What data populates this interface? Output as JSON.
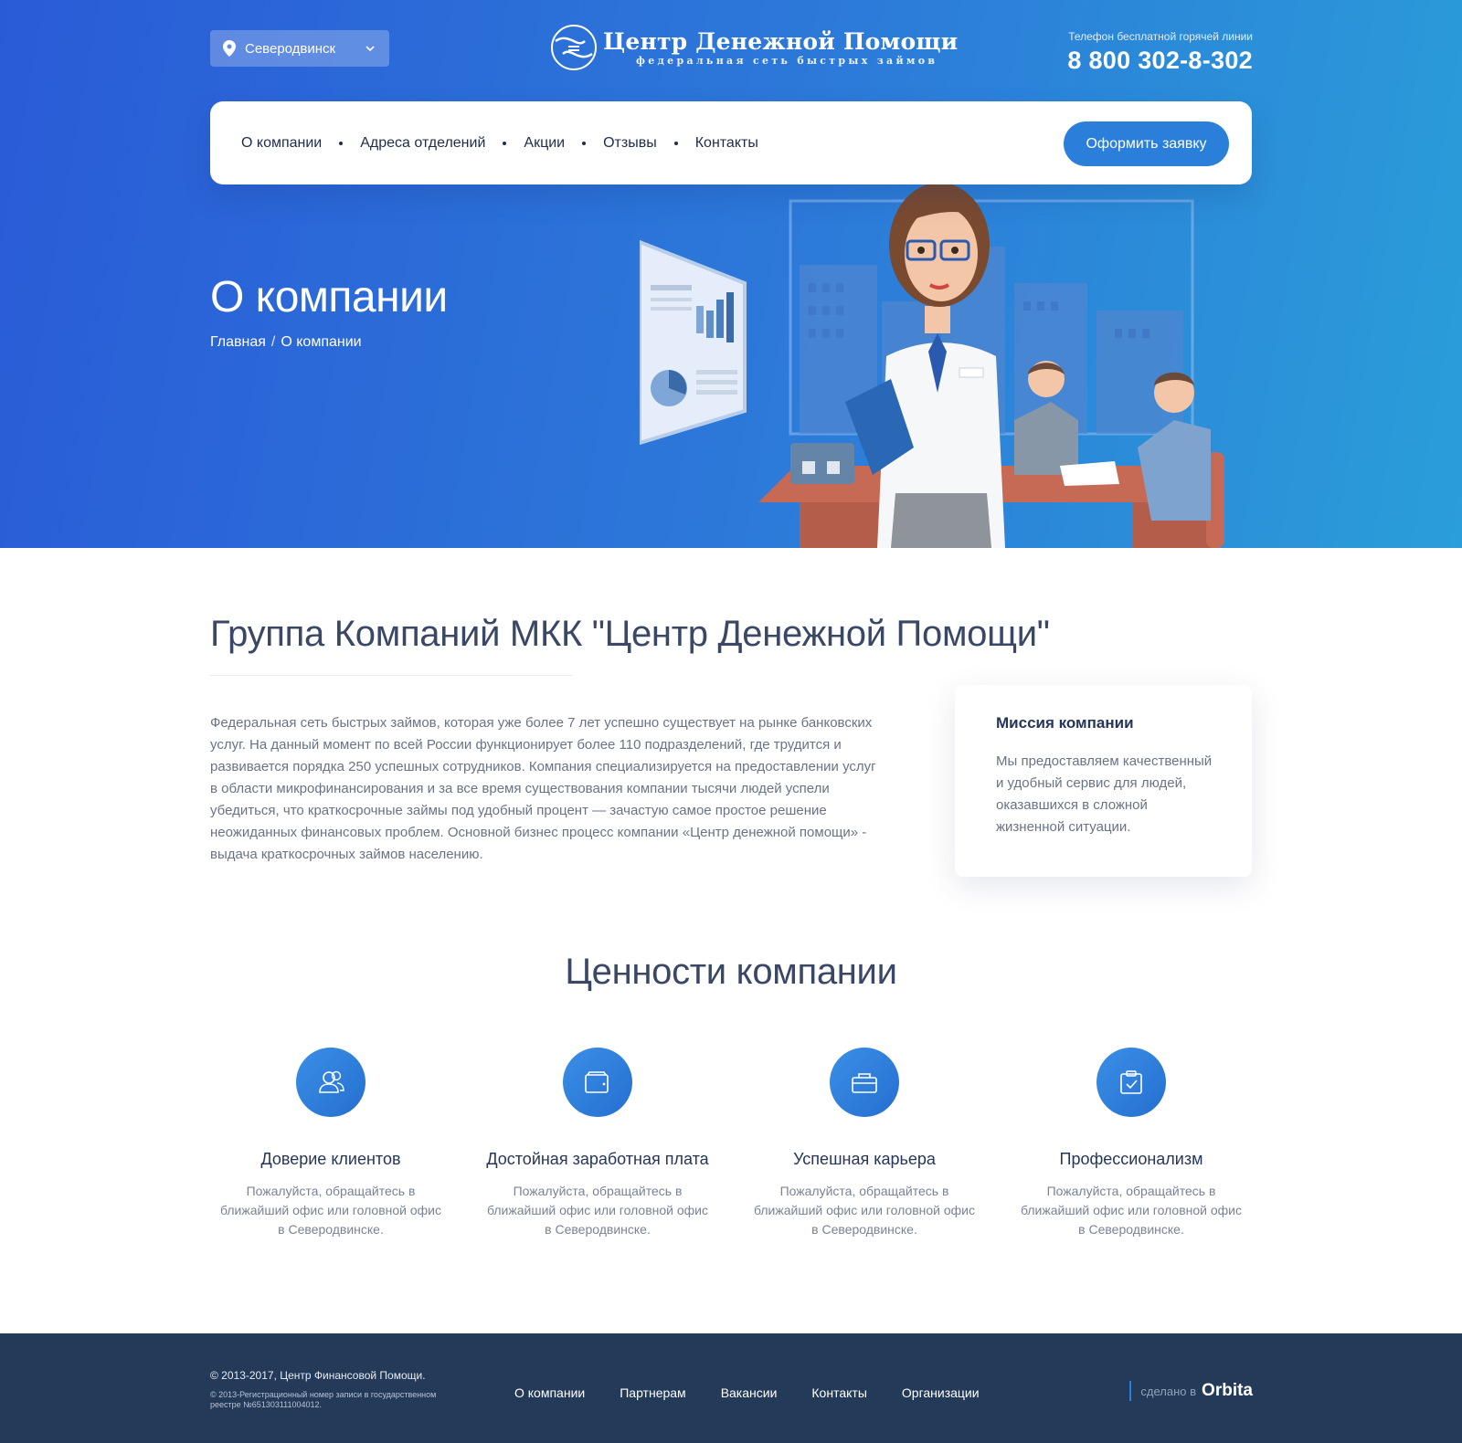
{
  "header": {
    "city": "Северодвинск",
    "logo_title": "Центр Денежной Помощи",
    "logo_subtitle": "федеральная сеть быстрых займов",
    "hotline_label": "Телефон бесплатной горячей линии",
    "hotline_phone": "8 800 302-8-302"
  },
  "nav": {
    "items": [
      "О компании",
      "Адреса отделений",
      "Акции",
      "Отзывы",
      "Контакты"
    ],
    "cta": "Оформить заявку"
  },
  "hero": {
    "title": "О компании",
    "breadcrumb_home": "Главная",
    "breadcrumb_sep": "/",
    "breadcrumb_current": "О компании"
  },
  "about": {
    "title": "Группа Компаний МКК \"Центр Денежной Помощи\"",
    "text": "Федеральная сеть быстрых займов, которая уже более 7 лет успешно существует на рынке банковских услуг. На данный момент по всей России функционирует более 110 подразделений, где трудится и развивается порядка 250 успешных сотрудников. Компания специализируется на предоставлении услуг в области микрофинансирования и за все время существования компании тысячи людей успели убедиться, что краткосрочные займы под удобный процент — зачастую самое простое решение неожиданных финансовых проблем. Основной бизнес процесс компании «Центр денежной помощи» - выдача краткосрочных займов населению.",
    "mission_title": "Миссия компании",
    "mission_text": "Мы предоставляем качественный и удобный сервис для людей, оказавшихся в сложной жизненной ситуации."
  },
  "values": {
    "title": "Ценности компании",
    "items": [
      {
        "icon": "users-icon",
        "title": "Доверие клиентов",
        "text": "Пожалуйста, обращайтесь в ближайший офис или головной офис в Северодвинске."
      },
      {
        "icon": "wallet-icon",
        "title": "Достойная заработная плата",
        "text": "Пожалуйста, обращайтесь в ближайший офис или головной офис в Северодвинске."
      },
      {
        "icon": "briefcase-icon",
        "title": "Успешная карьера",
        "text": "Пожалуйста, обращайтесь в ближайший офис или головной офис в Северодвинске."
      },
      {
        "icon": "clipboard-check-icon",
        "title": "Профессионализм",
        "text": "Пожалуйста, обращайтесь в ближайший офис или головной офис в Северодвинске."
      }
    ]
  },
  "footer": {
    "copyright": "© 2013-2017, Центр Финансовой Помощи.",
    "registration": "© 2013-Регистрационный номер записи в государственном реестре №651303111004012.",
    "links": [
      "О компании",
      "Партнерам",
      "Вакансии",
      "Контакты",
      "Организации"
    ],
    "made_label": "сделано в",
    "made_brand": "Orbita"
  },
  "colors": {
    "hero_gradient_start": "#2a5bd7",
    "hero_gradient_end": "#2a9ed9",
    "accent": "#2a7fdb",
    "footer_bg": "#243a59"
  }
}
